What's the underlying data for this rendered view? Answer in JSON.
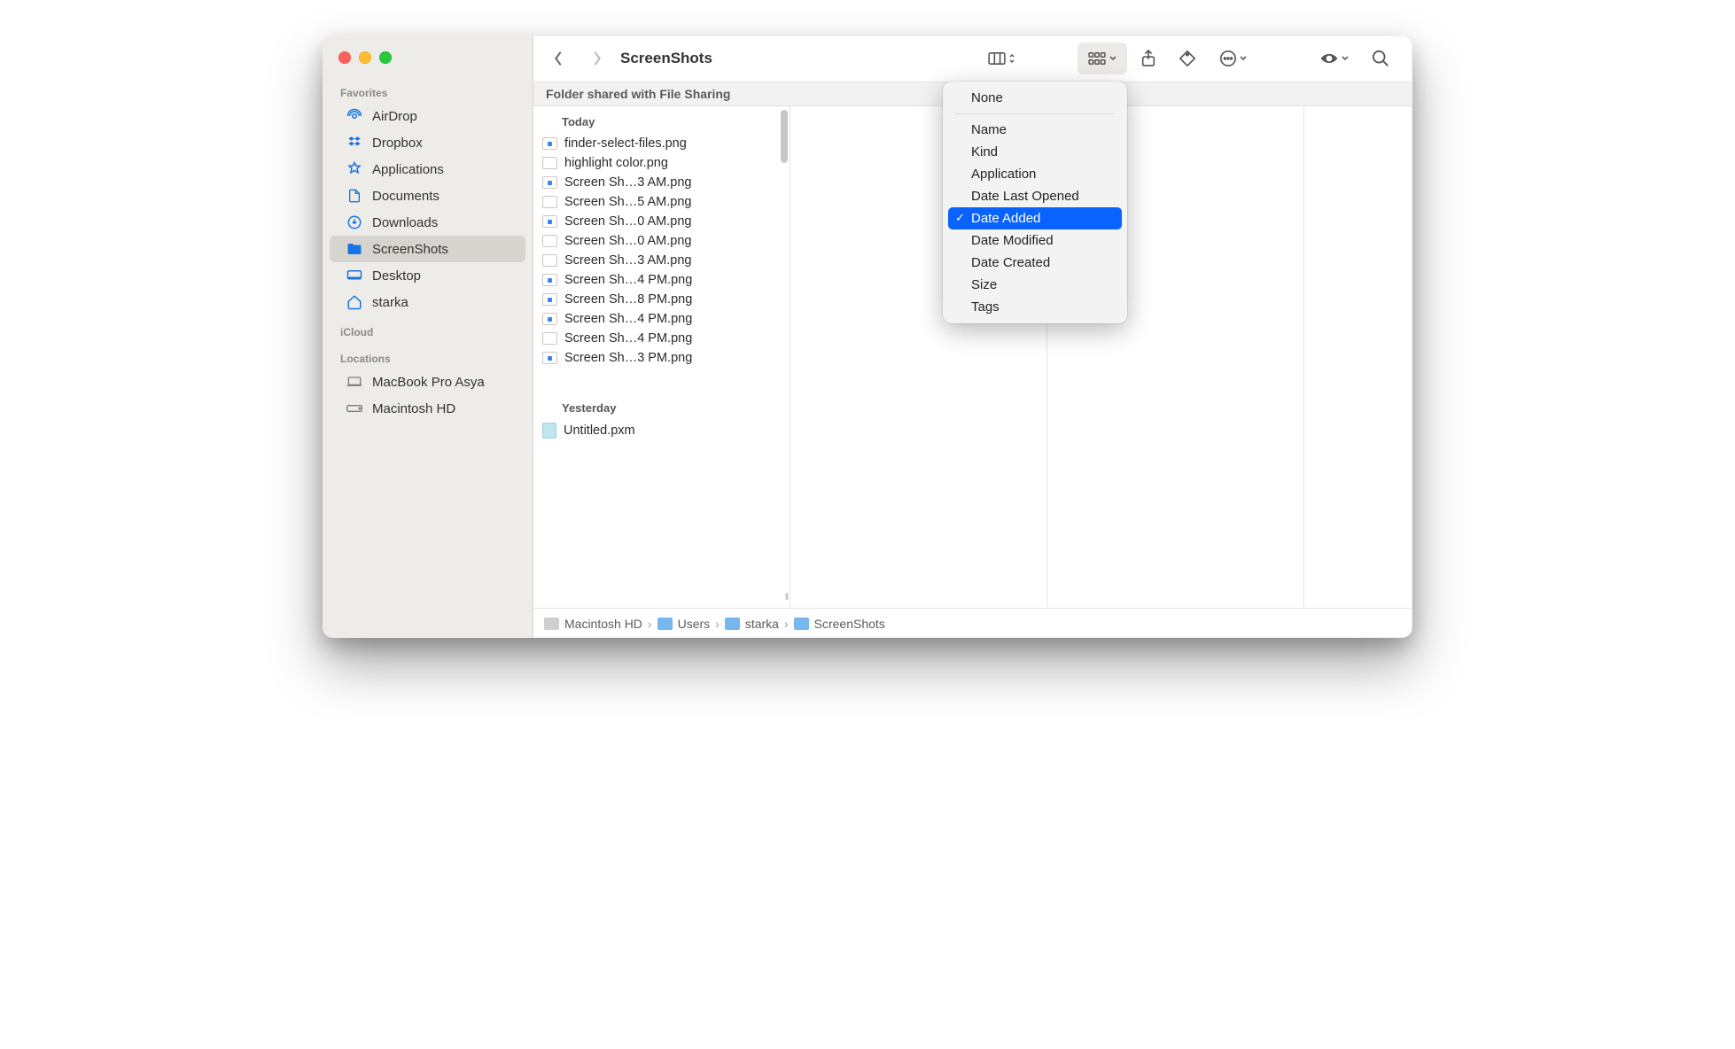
{
  "window_title": "ScreenShots",
  "share_banner": "Folder shared with File Sharing",
  "sidebar": {
    "sections": {
      "favorites": "Favorites",
      "icloud": "iCloud",
      "locations": "Locations"
    },
    "favorites": [
      {
        "icon": "airdrop",
        "label": "AirDrop"
      },
      {
        "icon": "dropbox",
        "label": "Dropbox"
      },
      {
        "icon": "applications",
        "label": "Applications"
      },
      {
        "icon": "documents",
        "label": "Documents"
      },
      {
        "icon": "downloads",
        "label": "Downloads"
      },
      {
        "icon": "folder",
        "label": "ScreenShots",
        "selected": true
      },
      {
        "icon": "desktop",
        "label": "Desktop"
      },
      {
        "icon": "home",
        "label": "starka"
      }
    ],
    "locations": [
      {
        "icon": "laptop",
        "label": "MacBook Pro Asya"
      },
      {
        "icon": "drive",
        "label": "Macintosh HD"
      }
    ]
  },
  "groups": [
    {
      "label": "Today",
      "files": [
        "finder-select-files.png",
        "highlight color.png",
        "Screen Sh…3 AM.png",
        "Screen Sh…5 AM.png",
        "Screen Sh…0 AM.png",
        "Screen Sh…0 AM.png",
        "Screen Sh…3 AM.png",
        "Screen Sh…4 PM.png",
        "Screen Sh…8 PM.png",
        "Screen Sh…4 PM.png",
        "Screen Sh…4 PM.png",
        "Screen Sh…3 PM.png"
      ]
    },
    {
      "label": "Yesterday",
      "files": [
        "Untitled.pxm"
      ]
    }
  ],
  "group_menu": {
    "none": "None",
    "items": [
      "Name",
      "Kind",
      "Application",
      "Date Last Opened",
      "Date Added",
      "Date Modified",
      "Date Created",
      "Size",
      "Tags"
    ],
    "selected_index": 4
  },
  "pathbar": [
    {
      "icon": "hd",
      "label": "Macintosh HD"
    },
    {
      "icon": "folder",
      "label": "Users"
    },
    {
      "icon": "folder",
      "label": "starka"
    },
    {
      "icon": "folder",
      "label": "ScreenShots"
    }
  ]
}
